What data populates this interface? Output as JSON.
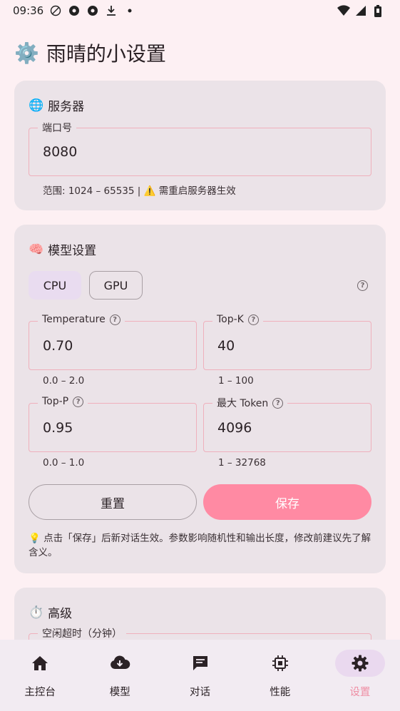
{
  "status": {
    "time": "09:36"
  },
  "page": {
    "title": "雨晴的小设置",
    "title_emoji": "⚙️"
  },
  "server": {
    "header_emoji": "🌐",
    "header": "服务器",
    "port_label": "端口号",
    "port_value": "8080",
    "hint": "范围: 1024 – 65535 | ⚠️ 需重启服务器生效"
  },
  "model": {
    "header_emoji": "🧠",
    "header": "模型设置",
    "seg_cpu": "CPU",
    "seg_gpu": "GPU",
    "temperature": {
      "label": "Temperature",
      "value": "0.70",
      "range": "0.0 – 2.0"
    },
    "topk": {
      "label": "Top-K",
      "value": "40",
      "range": "1 – 100"
    },
    "topp": {
      "label": "Top-P",
      "value": "0.95",
      "range": "0.0 – 1.0"
    },
    "maxtoken": {
      "label": "最大 Token",
      "value": "4096",
      "range": "1 – 32768"
    },
    "reset_label": "重置",
    "save_label": "保存",
    "note": "💡 点击「保存」后新对话生效。参数影响随机性和输出长度，修改前建议先了解含义。"
  },
  "advanced": {
    "header_emoji": "⏱️",
    "header": "高级",
    "idle_label": "空闲超时（分钟）"
  },
  "nav": {
    "items": [
      {
        "label": "主控台",
        "icon": "home-icon"
      },
      {
        "label": "模型",
        "icon": "cloud-download-icon"
      },
      {
        "label": "对话",
        "icon": "chat-icon"
      },
      {
        "label": "性能",
        "icon": "chip-icon"
      },
      {
        "label": "设置",
        "icon": "gear-icon"
      }
    ],
    "active_color": "#ef8ea4"
  }
}
